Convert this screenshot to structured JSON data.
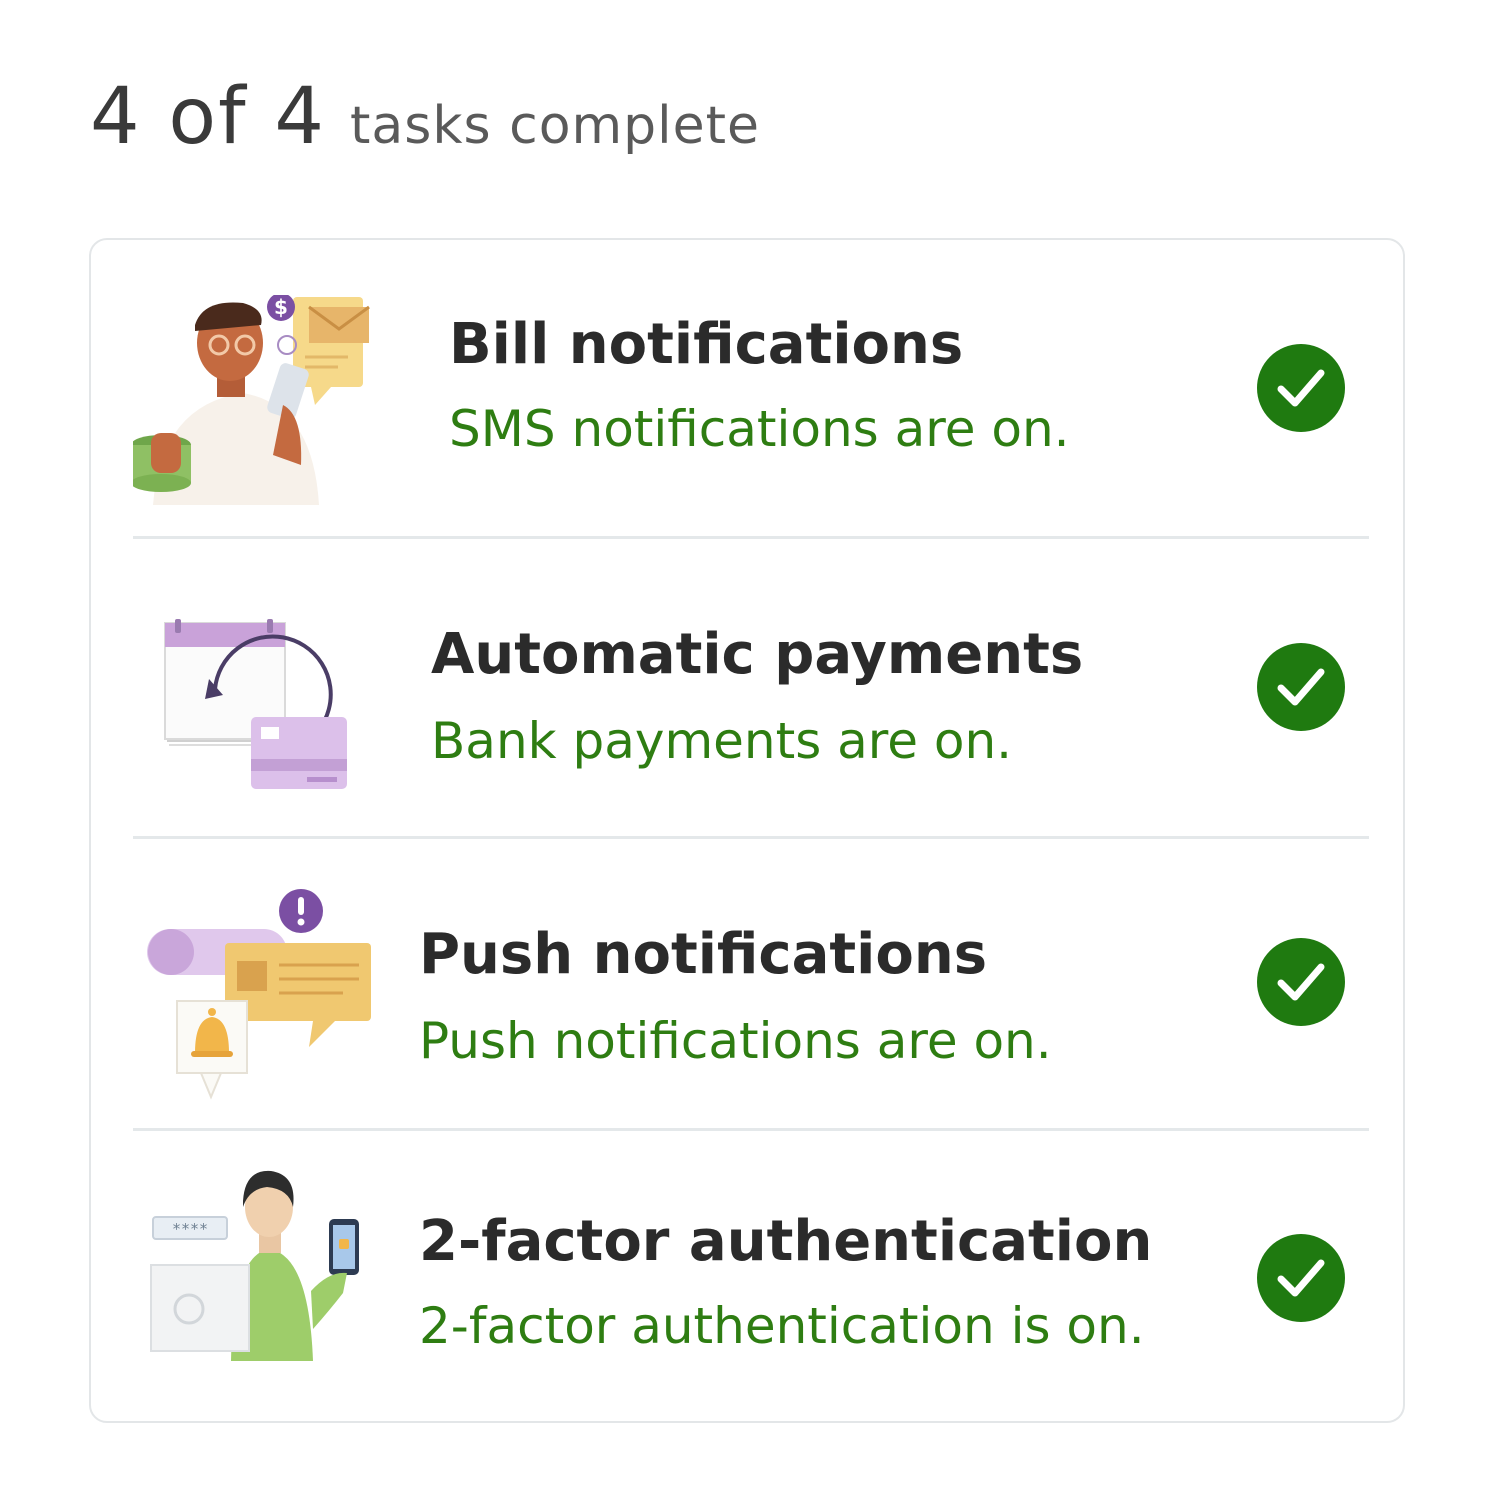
{
  "progress": {
    "count": "4 of 4",
    "label": "tasks complete",
    "completed": 4,
    "total": 4
  },
  "colors": {
    "status_green": "#2e7d12",
    "check_green": "#1f7a10",
    "title_text": "#2b2b2b"
  },
  "tasks": [
    {
      "title": "Bill notifications",
      "status": "SMS notifications are on.",
      "illustration": "person-phone-bill-illustration",
      "complete": true
    },
    {
      "title": "Automatic payments",
      "status": "Bank payments are on.",
      "illustration": "calendar-card-illustration",
      "complete": true
    },
    {
      "title": "Push notifications",
      "status": "Push notifications are on.",
      "illustration": "chat-bell-illustration",
      "complete": true
    },
    {
      "title": "2-factor authentication",
      "status": "2-factor authentication is on.",
      "illustration": "person-laptop-lock-illustration",
      "complete": true
    }
  ]
}
